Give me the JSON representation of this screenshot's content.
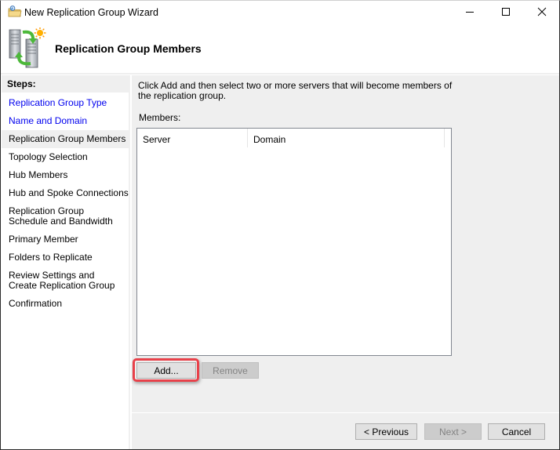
{
  "window": {
    "title": "New Replication Group Wizard",
    "title_icon": "folder-replication-icon",
    "controls": {
      "minimize": "minimize-icon",
      "maximize": "maximize-icon",
      "close": "close-icon"
    }
  },
  "header": {
    "icon": "replication-servers-icon",
    "title": "Replication Group Members"
  },
  "sidebar": {
    "heading": "Steps:",
    "items": [
      {
        "label": "Replication Group Type",
        "state": "completed-link"
      },
      {
        "label": "Name and Domain",
        "state": "completed-link"
      },
      {
        "label": "Replication Group Members",
        "state": "current"
      },
      {
        "label": "Topology Selection",
        "state": "pending"
      },
      {
        "label": "Hub Members",
        "state": "pending"
      },
      {
        "label": "Hub and Spoke Connections",
        "state": "pending"
      },
      {
        "label": "Replication Group Schedule and Bandwidth",
        "state": "pending"
      },
      {
        "label": "Primary Member",
        "state": "pending"
      },
      {
        "label": "Folders to Replicate",
        "state": "pending"
      },
      {
        "label": "Review Settings and Create Replication Group",
        "state": "pending"
      },
      {
        "label": "Confirmation",
        "state": "pending"
      }
    ]
  },
  "main": {
    "instructions": "Click Add and then select two or more servers that will become members of the replication group.",
    "members_label": "Members:",
    "columns": [
      "Server",
      "Domain"
    ],
    "rows": [],
    "add_label": "Add...",
    "remove_label": "Remove",
    "add_highlight_color": "#e8414a"
  },
  "footer": {
    "previous_label": "< Previous",
    "next_label": "Next >",
    "cancel_label": "Cancel"
  }
}
